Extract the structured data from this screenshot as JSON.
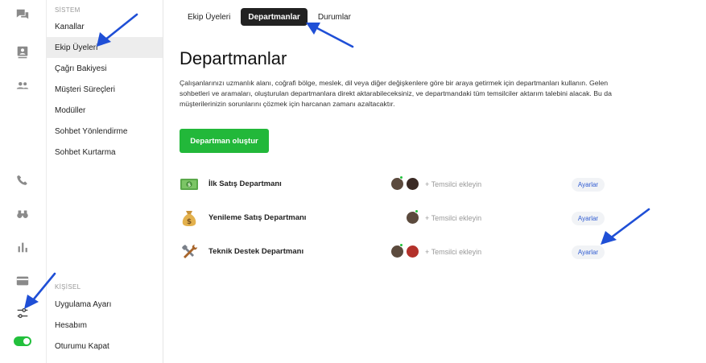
{
  "rail": {
    "icons": [
      "chat-icon",
      "contact-card-icon",
      "people-icon",
      "phone-icon",
      "binoculars-icon",
      "bar-chart-icon",
      "credit-card-icon",
      "sliders-icon"
    ],
    "toggle_on": true
  },
  "menu": {
    "section_system": "SİSTEM",
    "items_system": [
      "Kanallar",
      "Ekip Üyeleri",
      "Çağrı Bakiyesi",
      "Müşteri Süreçleri",
      "Modüller",
      "Sohbet Yönlendirme",
      "Sohbet Kurtarma"
    ],
    "section_personal": "KİŞİSEL",
    "items_personal": [
      "Uygulama Ayarı",
      "Hesabım",
      "Oturumu Kapat"
    ]
  },
  "tabs": [
    "Ekip Üyeleri",
    "Departmanlar",
    "Durumlar"
  ],
  "page": {
    "title": "Departmanlar",
    "description": "Çalışanlarınızı uzmanlık alanı, coğrafi bölge, meslek, dil veya diğer değişkenlere göre bir araya getirmek için departmanları kullanın. Gelen sohbetleri ve aramaları, oluşturulan departmanlara direkt aktarabileceksiniz, ve departmandaki tüm temsilciler aktarım talebini alacak. Bu da müşterilerinizin sorunlarını çözmek için harcanan zamanı azaltacaktır.",
    "create_button": "Departman oluştur"
  },
  "departments": [
    {
      "name": "İlk Satış Departmanı",
      "emoji": "money-icon",
      "add_label": "+ Temsilci ekleyin",
      "settings_label": "Ayarlar"
    },
    {
      "name": "Yenileme Satış Departmanı",
      "emoji": "money-bag-icon",
      "add_label": "+ Temsilci ekleyin",
      "settings_label": "Ayarlar"
    },
    {
      "name": "Teknik Destek Departmanı",
      "emoji": "tools-icon",
      "add_label": "+ Temsilci ekleyin",
      "settings_label": "Ayarlar"
    }
  ],
  "colors": {
    "accent_green": "#22b83a",
    "link_blue": "#2f5bd1",
    "arrow_blue": "#1f4fd6"
  }
}
